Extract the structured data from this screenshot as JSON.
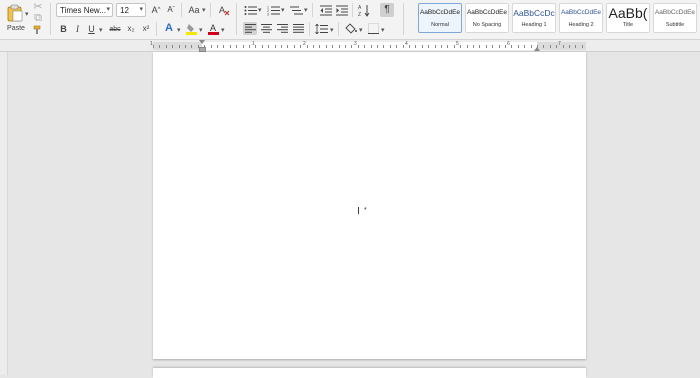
{
  "toolbar": {
    "paste_label": "Paste",
    "font_name": "Times New...",
    "font_size": "12",
    "change_case_label": "Aa",
    "bold": "B",
    "italic": "I",
    "underline": "U",
    "strikethrough": "abc",
    "subscript": "x₂",
    "superscript": "x²",
    "text_effects": "A",
    "highlight": "✎",
    "font_color": "A",
    "grow_font": "A^",
    "shrink_font": "Aˇ",
    "show_marks": "¶",
    "font_color_hex": "#d0021b",
    "highlight_hex": "#f5e700"
  },
  "styles": [
    {
      "preview": "AaBbCcDdEe",
      "name": "Normal"
    },
    {
      "preview": "AaBbCcDdEe",
      "name": "No Spacing"
    },
    {
      "preview": "AaBbCcDc",
      "name": "Heading 1"
    },
    {
      "preview": "AaBbCcDdEe",
      "name": "Heading 2"
    },
    {
      "preview": "AaBb(",
      "name": "Title"
    },
    {
      "preview": "AaBbCcDdEe",
      "name": "Subtitle"
    }
  ],
  "ruler": {
    "numbers": [
      "1",
      "1",
      "2",
      "3",
      "4",
      "5",
      "6",
      "7"
    ]
  },
  "cursor_glyph": "I"
}
